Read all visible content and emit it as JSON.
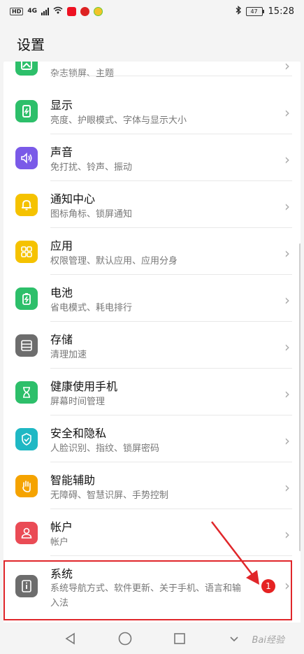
{
  "status_bar": {
    "hd": "HD",
    "network": "4G",
    "battery": "47",
    "time": "15:28"
  },
  "page": {
    "title": "设置"
  },
  "settings": [
    {
      "title": "",
      "subtitle": "杂志锁屏、主题",
      "icon": "wallpaper-icon",
      "color": "#2dbf6a"
    },
    {
      "title": "显示",
      "subtitle": "亮度、护眼模式、字体与显示大小",
      "icon": "display-icon",
      "color": "#2dbf6a"
    },
    {
      "title": "声音",
      "subtitle": "免打扰、铃声、振动",
      "icon": "sound-icon",
      "color": "#7a5ae8"
    },
    {
      "title": "通知中心",
      "subtitle": "图标角标、锁屏通知",
      "icon": "bell-icon",
      "color": "#f5c200"
    },
    {
      "title": "应用",
      "subtitle": "权限管理、默认应用、应用分身",
      "icon": "apps-icon",
      "color": "#f5c200"
    },
    {
      "title": "电池",
      "subtitle": "省电模式、耗电排行",
      "icon": "battery-icon",
      "color": "#2dbf6a"
    },
    {
      "title": "存储",
      "subtitle": "清理加速",
      "icon": "storage-icon",
      "color": "#6d6d6d"
    },
    {
      "title": "健康使用手机",
      "subtitle": "屏幕时间管理",
      "icon": "hourglass-icon",
      "color": "#2dbf6a"
    },
    {
      "title": "安全和隐私",
      "subtitle": "人脸识别、指纹、锁屏密码",
      "icon": "shield-icon",
      "color": "#1fb8c4"
    },
    {
      "title": "智能辅助",
      "subtitle": "无障碍、智慧识屏、手势控制",
      "icon": "hand-icon",
      "color": "#f5a300"
    },
    {
      "title": "帐户",
      "subtitle": "帐户",
      "icon": "user-icon",
      "color": "#ea4b55"
    },
    {
      "title": "系统",
      "subtitle": "系统导航方式、软件更新、关于手机、语言和输入法",
      "icon": "system-icon",
      "color": "#6d6d6d",
      "badge": "1"
    }
  ],
  "watermark": "Bai经验"
}
